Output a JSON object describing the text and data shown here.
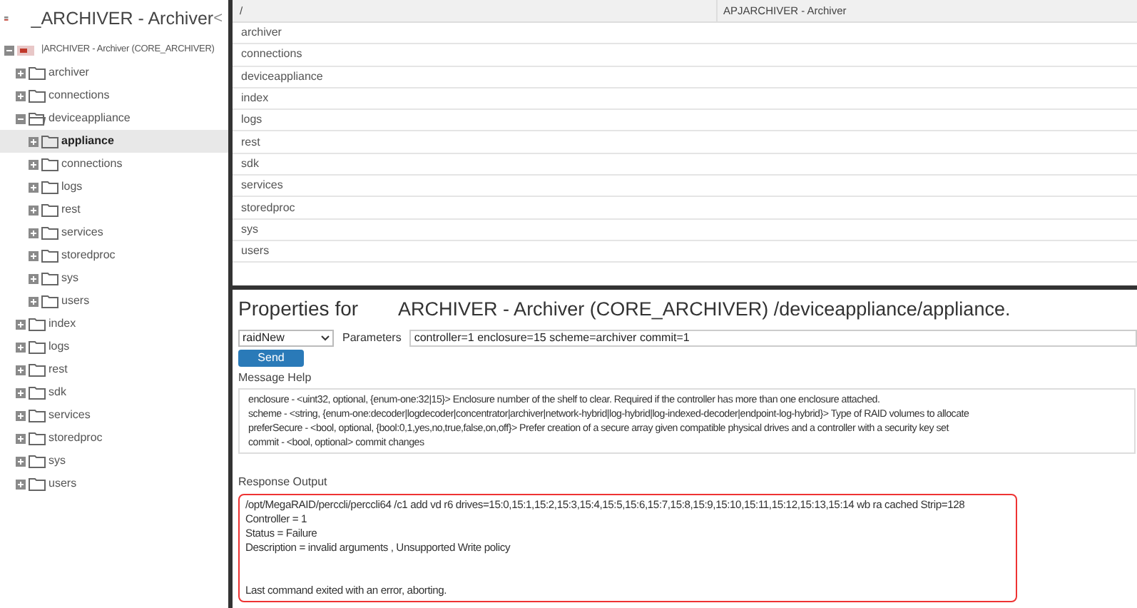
{
  "sidebar": {
    "title": "_ARCHIVER - Archiver",
    "collapse": "<",
    "tree": [
      {
        "label": "|ARCHIVER - Archiver (CORE_ARCHIVER)",
        "kind": "device",
        "expanded": true,
        "selected": false,
        "children": [
          {
            "label": "archiver",
            "kind": "folder",
            "expanded": false,
            "selected": false
          },
          {
            "label": "connections",
            "kind": "folder",
            "expanded": false,
            "selected": false
          },
          {
            "label": "deviceappliance",
            "kind": "folder",
            "expanded": true,
            "selected": false,
            "children": [
              {
                "label": "appliance",
                "kind": "folder",
                "expanded": false,
                "selected": true
              },
              {
                "label": "connections",
                "kind": "folder",
                "expanded": false,
                "selected": false
              },
              {
                "label": "logs",
                "kind": "folder",
                "expanded": false,
                "selected": false
              },
              {
                "label": "rest",
                "kind": "folder",
                "expanded": false,
                "selected": false
              },
              {
                "label": "services",
                "kind": "folder",
                "expanded": false,
                "selected": false
              },
              {
                "label": "storedproc",
                "kind": "folder",
                "expanded": false,
                "selected": false
              },
              {
                "label": "sys",
                "kind": "folder",
                "expanded": false,
                "selected": false
              },
              {
                "label": "users",
                "kind": "folder",
                "expanded": false,
                "selected": false
              }
            ]
          },
          {
            "label": "index",
            "kind": "folder",
            "expanded": false,
            "selected": false
          },
          {
            "label": "logs",
            "kind": "folder",
            "expanded": false,
            "selected": false
          },
          {
            "label": "rest",
            "kind": "folder",
            "expanded": false,
            "selected": false
          },
          {
            "label": "sdk",
            "kind": "folder",
            "expanded": false,
            "selected": false
          },
          {
            "label": "services",
            "kind": "folder",
            "expanded": false,
            "selected": false
          },
          {
            "label": "storedproc",
            "kind": "folder",
            "expanded": false,
            "selected": false
          },
          {
            "label": "sys",
            "kind": "folder",
            "expanded": false,
            "selected": false
          },
          {
            "label": "users",
            "kind": "folder",
            "expanded": false,
            "selected": false
          }
        ]
      }
    ]
  },
  "table": {
    "columns": [
      "/",
      "APJARCHIVER - Archiver"
    ],
    "rows": [
      "archiver",
      "connections",
      "deviceappliance",
      "index",
      "logs",
      "rest",
      "sdk",
      "services",
      "storedproc",
      "sys",
      "users"
    ]
  },
  "properties": {
    "label": "Properties for",
    "title": "ARCHIVER - Archiver (CORE_ARCHIVER) /deviceappliance/appliance.",
    "command": "raidNew",
    "parameters_label": "Parameters",
    "parameters": "controller=1 enclosure=15 scheme=archiver commit=1",
    "send": "Send",
    "help_label": "Message Help",
    "help_lines": [
      "enclosure - <uint32, optional, {enum-one:32|15}> Enclosure number of the shelf to clear.  Required if the controller has more than one enclosure attached.",
      "scheme - <string, {enum-one:decoder|logdecoder|concentrator|archiver|network-hybrid|log-hybrid|log-indexed-decoder|endpoint-log-hybrid}> Type of RAID volumes to allocate",
      "preferSecure - <bool, optional, {bool:0,1,yes,no,true,false,on,off}> Prefer creation of a secure array given compatible physical drives and a controller with a security key set",
      "commit - <bool, optional> commit changes"
    ],
    "output_label": "Response Output",
    "output_lines": [
      "/opt/MegaRAID/perccli/perccli64 /c1 add vd r6 drives=15:0,15:1,15:2,15:3,15:4,15:5,15:6,15:7,15:8,15:9,15:10,15:11,15:12,15:13,15:14 wb ra cached Strip=128",
      "Controller = 1",
      "Status = Failure",
      "Description = invalid arguments , Unsupported Write policy"
    ],
    "output_footer": "Last command exited with an error, aborting."
  }
}
